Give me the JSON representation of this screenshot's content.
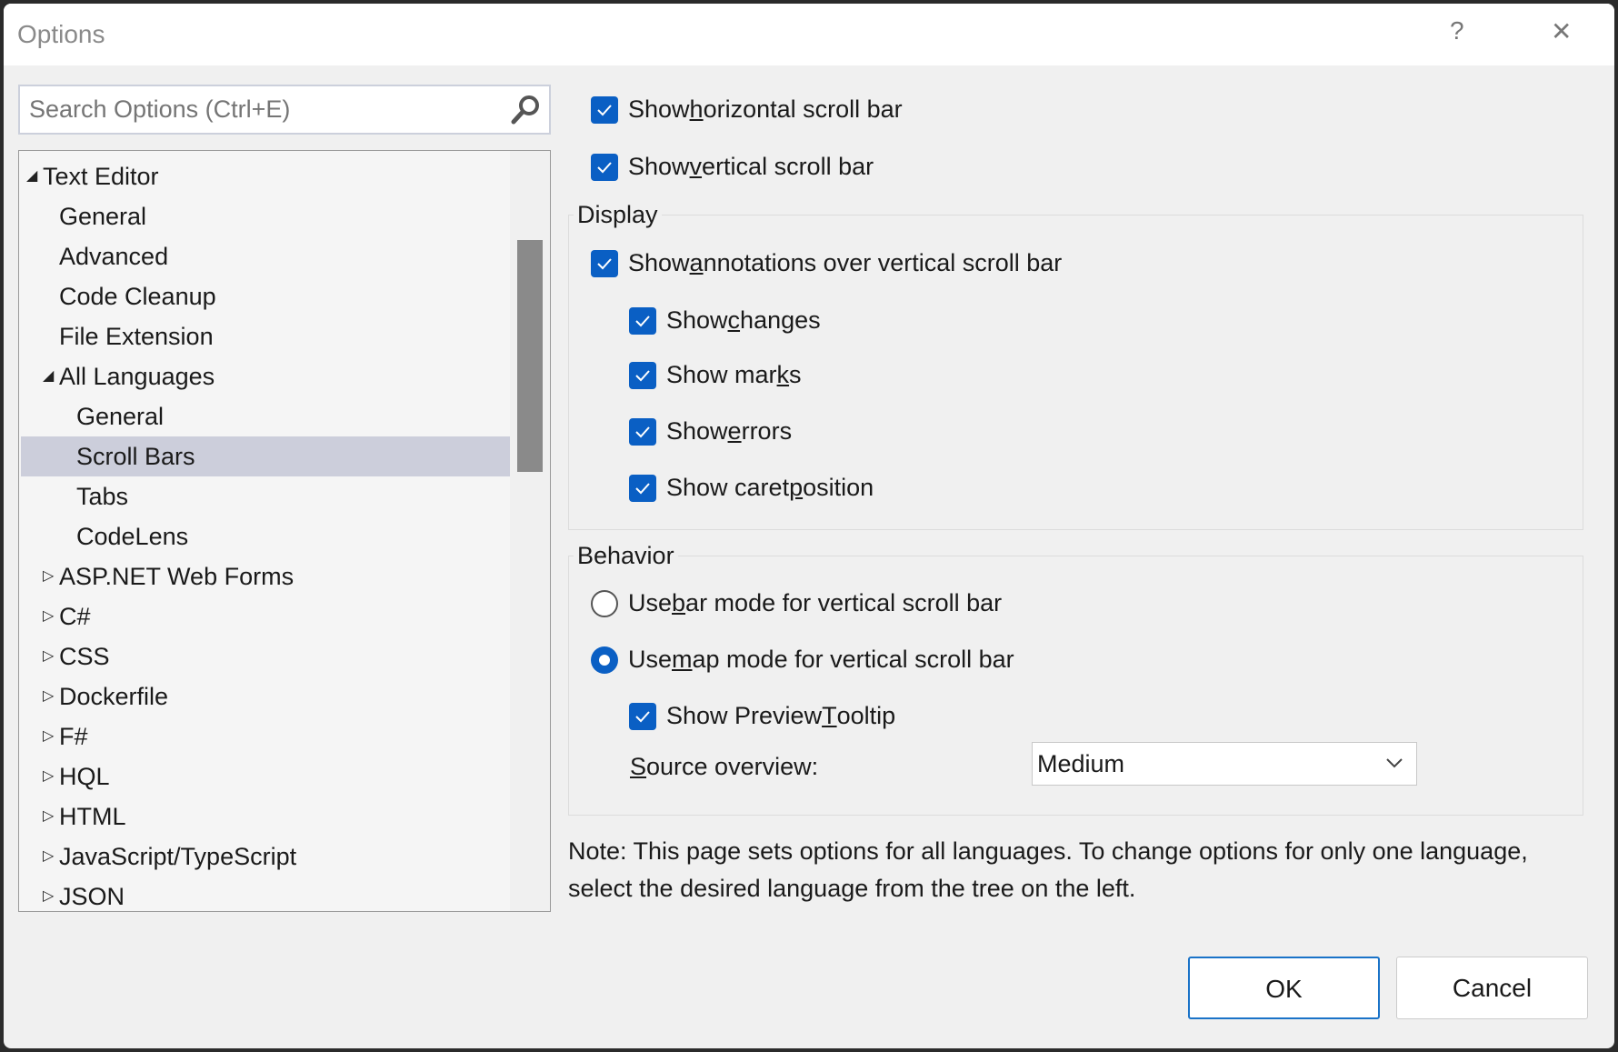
{
  "window": {
    "title": "Options",
    "help_label": "?",
    "close_label": "✕"
  },
  "search": {
    "placeholder": "Search Options (Ctrl+E)",
    "icon": "search-icon"
  },
  "tree": {
    "items": [
      {
        "label": "Text Editor",
        "level": 0,
        "expander": "expanded"
      },
      {
        "label": "General",
        "level": 1
      },
      {
        "label": "Advanced",
        "level": 1
      },
      {
        "label": "Code Cleanup",
        "level": 1
      },
      {
        "label": "File Extension",
        "level": 1
      },
      {
        "label": "All Languages",
        "level": 1,
        "expander": "expanded"
      },
      {
        "label": "General",
        "level": 2
      },
      {
        "label": "Scroll Bars",
        "level": 2,
        "selected": true
      },
      {
        "label": "Tabs",
        "level": 2
      },
      {
        "label": "CodeLens",
        "level": 2
      },
      {
        "label": "ASP.NET Web Forms",
        "level": 1,
        "expander": "collapsed"
      },
      {
        "label": "C#",
        "level": 1,
        "expander": "collapsed"
      },
      {
        "label": "CSS",
        "level": 1,
        "expander": "collapsed"
      },
      {
        "label": "Dockerfile",
        "level": 1,
        "expander": "collapsed"
      },
      {
        "label": "F#",
        "level": 1,
        "expander": "collapsed"
      },
      {
        "label": "HQL",
        "level": 1,
        "expander": "collapsed"
      },
      {
        "label": "HTML",
        "level": 1,
        "expander": "collapsed"
      },
      {
        "label": "JavaScript/TypeScript",
        "level": 1,
        "expander": "collapsed"
      },
      {
        "label": "JSON",
        "level": 1,
        "expander": "collapsed"
      }
    ]
  },
  "options": {
    "horizontal": {
      "pre": "Show ",
      "key": "h",
      "post": "orizontal scroll bar",
      "checked": true
    },
    "vertical": {
      "pre": "Show ",
      "key": "v",
      "post": "ertical scroll bar",
      "checked": true
    },
    "display": {
      "label": "Display",
      "annotations": {
        "pre": "Show ",
        "key": "a",
        "post": "nnotations over vertical scroll bar",
        "checked": true
      },
      "changes": {
        "pre": "Show ",
        "key": "c",
        "post": "hanges",
        "checked": true
      },
      "marks": {
        "pre": "Show mar",
        "key": "k",
        "post": "s",
        "checked": true
      },
      "errors": {
        "pre": "Show ",
        "key": "e",
        "post": "rrors",
        "checked": true
      },
      "caret": {
        "pre": "Show caret ",
        "key": "p",
        "post": "osition",
        "checked": true
      }
    },
    "behavior": {
      "label": "Behavior",
      "bar_mode": {
        "pre": "Use ",
        "key": "b",
        "post": "ar mode for vertical scroll bar",
        "selected": false
      },
      "map_mode": {
        "pre": "Use ",
        "key": "m",
        "post": "ap mode for vertical scroll bar",
        "selected": true
      },
      "preview": {
        "pre": "Show Preview ",
        "key": "T",
        "post": "ooltip",
        "checked": true
      },
      "source_overview": {
        "key": "S",
        "post": "ource overview:",
        "value": "Medium"
      }
    }
  },
  "note": "Note: This page sets options for all languages. To change options for only one language, select the desired language from the tree on the left.",
  "buttons": {
    "ok": "OK",
    "cancel": "Cancel"
  },
  "colors": {
    "accent": "#0a5fc4",
    "selection": "#cccedb"
  }
}
